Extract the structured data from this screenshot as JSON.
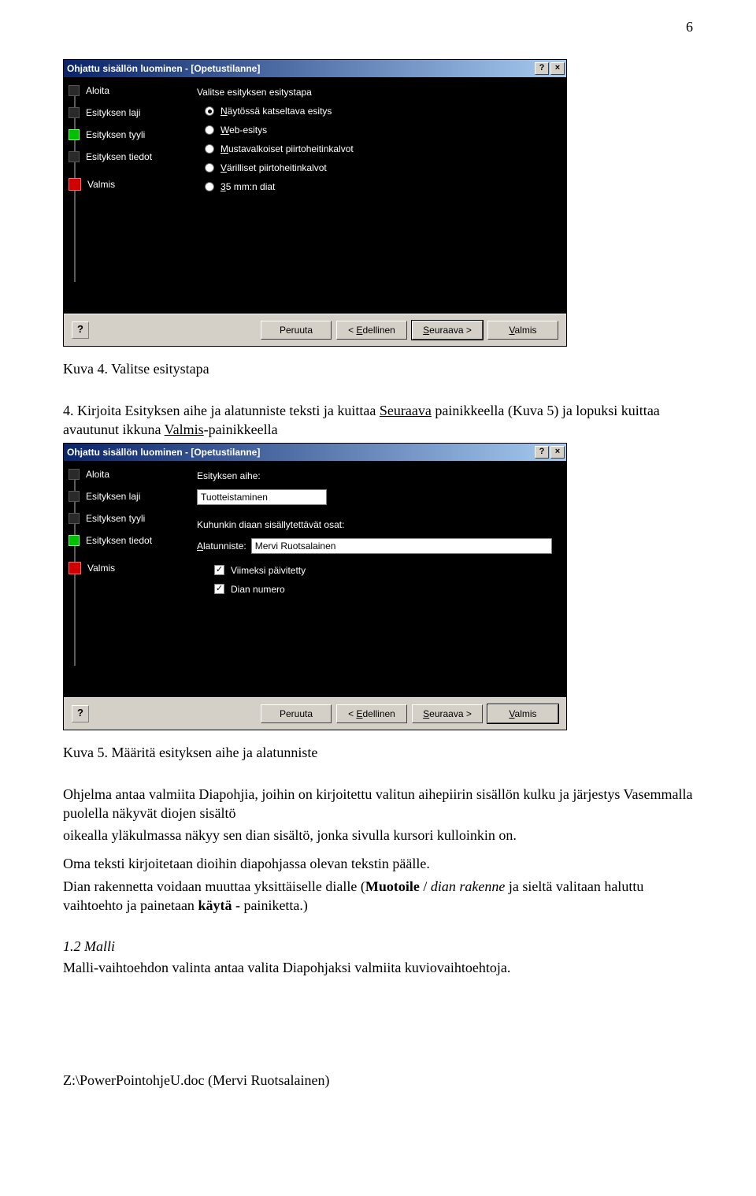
{
  "page_number": "6",
  "caption1": "Kuva 4. Valitse esitystapa",
  "instr4_parts": {
    "prefix": "4. Kirjoita  Esityksen aihe ja alatunniste teksti ja kuittaa ",
    "link1": "Seuraava",
    "mid1": " painikkeella (Kuva  5) ja lopuksi kuittaa avautunut ikkuna ",
    "link2": "Valmis",
    "suffix": "-painikkeella"
  },
  "caption2": "Kuva 5. Määritä esityksen aihe ja alatunniste",
  "para1": "Ohjelma antaa valmiita Diapohjia, joihin on kirjoitettu valitun aihepiirin sisällön kulku ja järjestys Vasemmalla puolella näkyvät diojen sisältö",
  "para2": "oikealla yläkulmassa näkyy sen dian sisältö, jonka sivulla kursori kulloinkin on.",
  "para3": "Oma teksti kirjoitetaan dioihin diapohjassa olevan tekstin päälle.",
  "para4_parts": {
    "p1": "Dian  rakennetta voidaan muuttaa yksittäiselle dialle (",
    "b1": "Muotoile",
    "p2": " / ",
    "i1": "dian rakenne",
    "p3": " ja sieltä valitaan haluttu vaihtoehto ja painetaan ",
    "b2": "käytä",
    "p4": " - painiketta.)"
  },
  "section12_title": "1.2 Malli",
  "section12_body": "Malli-vaihtoehdon valinta antaa valita Diapohjaksi valmiita kuviovaihtoehtoja.",
  "footer": "Z:\\PowerPointohjeU.doc (Mervi Ruotsalainen)",
  "dialog1": {
    "title": "Ohjattu sisällön luominen - [Opetustilanne]",
    "nav": [
      "Aloita",
      "Esityksen laji",
      "Esityksen tyyli",
      "Esityksen tiedot",
      "Valmis"
    ],
    "group_label": "Valitse esityksen esitystapa",
    "options": [
      {
        "accel": "N",
        "rest": "äytössä katseltava esitys",
        "selected": true
      },
      {
        "accel": "W",
        "rest": "eb-esitys",
        "selected": false
      },
      {
        "accel": "M",
        "rest": "ustavalkoiset piirtoheitinkalvot",
        "selected": false
      },
      {
        "accel": "V",
        "rest": "ärilliset piirtoheitinkalvot",
        "selected": false
      },
      {
        "accel": "3",
        "rest": "5 mm:n diat",
        "selected": false
      }
    ],
    "buttons": {
      "cancel": "Peruuta",
      "back_accel": "E",
      "back_rest": "dellinen",
      "next_accel": "S",
      "next_rest": "euraava >",
      "back_prefix": "< ",
      "finish_accel": "V",
      "finish_rest": "almis"
    }
  },
  "dialog2": {
    "title": "Ohjattu sisällön luominen - [Opetustilanne]",
    "nav": [
      "Aloita",
      "Esityksen laji",
      "Esityksen tyyli",
      "Esityksen tiedot",
      "Valmis"
    ],
    "topic_label": "Esityksen aihe:",
    "topic_value": "Tuotteistaminen",
    "parts_label": "Kuhunkin diaan sisällytettävät osat:",
    "footer_label_accel": "A",
    "footer_label_rest": "latunniste:",
    "footer_value": "Mervi Ruotsalainen",
    "chk1": "Viimeksi päivitetty",
    "chk2": "Dian numero",
    "buttons": {
      "cancel": "Peruuta",
      "back_accel": "E",
      "back_rest": "dellinen",
      "next_accel": "S",
      "next_rest": "euraava >",
      "back_prefix": "< ",
      "finish_accel": "V",
      "finish_rest": "almis"
    }
  },
  "tb": {
    "help": "?",
    "close": "×"
  }
}
